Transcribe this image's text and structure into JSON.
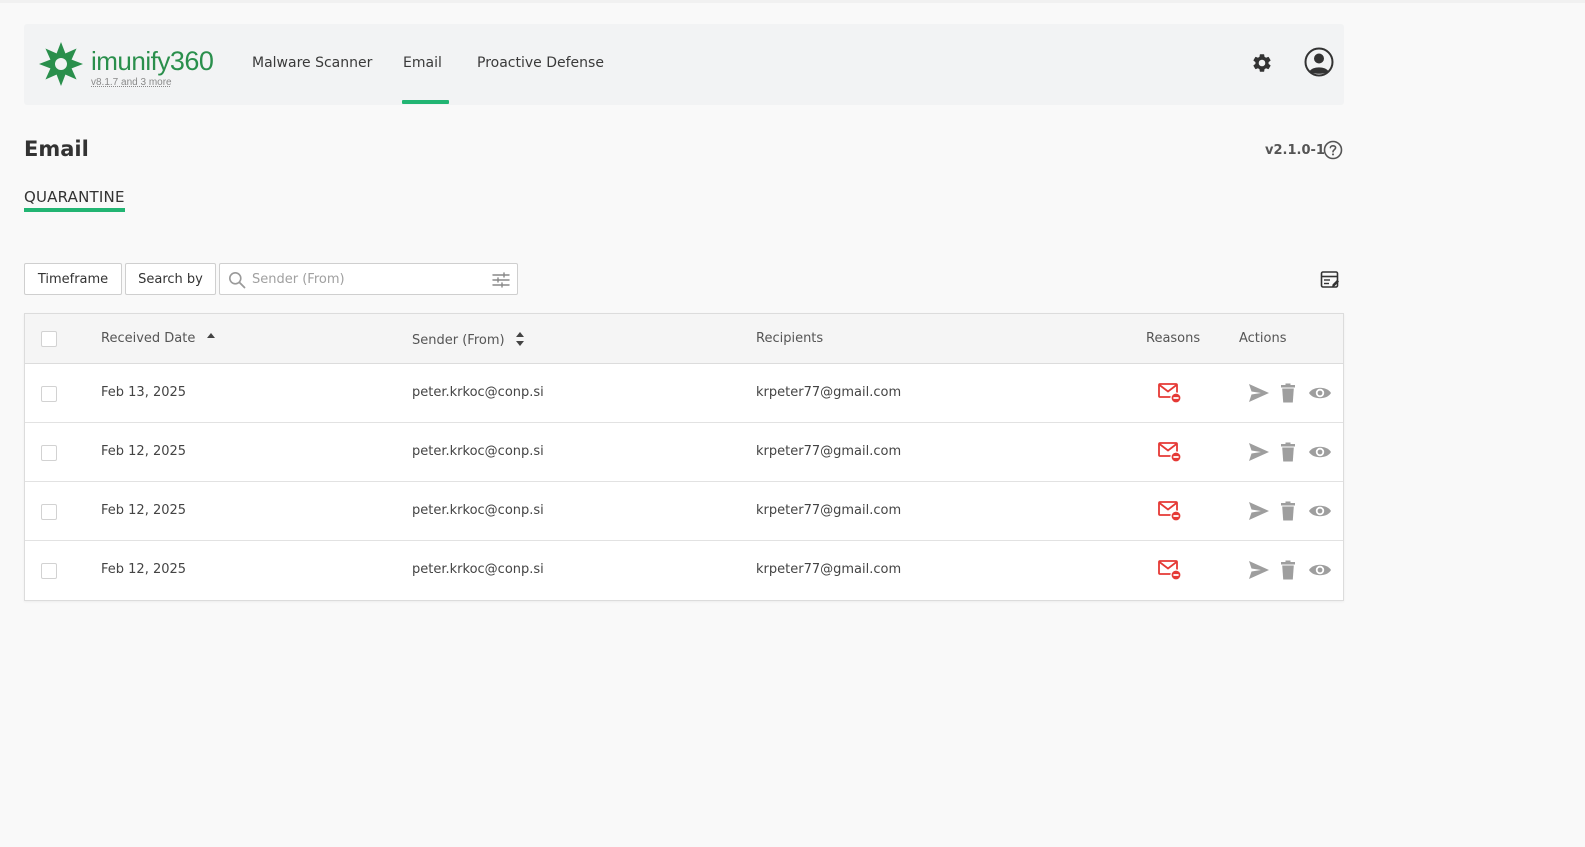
{
  "header": {
    "brand_text": "imunify",
    "brand_num": "360",
    "version_link": "v8.1.7 and 3 more",
    "nav": [
      {
        "label": "Malware Scanner"
      },
      {
        "label": "Email"
      },
      {
        "label": "Proactive Defense"
      }
    ],
    "active_nav": "Email",
    "icons": {
      "settings": "gear-icon",
      "user": "user-avatar-icon"
    }
  },
  "page": {
    "title": "Email",
    "version": "v2.1.0-1",
    "tab": "QUARANTINE"
  },
  "toolbar": {
    "timeframe_label": "Timeframe",
    "searchby_label": "Search by",
    "search_placeholder": "Sender (From)",
    "search_value": ""
  },
  "table": {
    "columns": {
      "received": "Received Date",
      "sender": "Sender (From)",
      "recipients": "Recipients",
      "reasons": "Reasons",
      "actions": "Actions"
    },
    "rows": [
      {
        "date": "Feb 13, 2025",
        "sender": "peter.krkoc@conp.si",
        "recipient": "krpeter77@gmail.com",
        "reason_icon": "mail-blocked-icon"
      },
      {
        "date": "Feb 12, 2025",
        "sender": "peter.krkoc@conp.si",
        "recipient": "krpeter77@gmail.com",
        "reason_icon": "mail-blocked-icon"
      },
      {
        "date": "Feb 12, 2025",
        "sender": "peter.krkoc@conp.si",
        "recipient": "krpeter77@gmail.com",
        "reason_icon": "mail-blocked-icon"
      },
      {
        "date": "Feb 12, 2025",
        "sender": "peter.krkoc@conp.si",
        "recipient": "krpeter77@gmail.com",
        "reason_icon": "mail-blocked-icon"
      }
    ]
  },
  "colors": {
    "accent": "#22b573",
    "brand": "#2a8f4c",
    "reason_red": "#e53935",
    "action_gray": "#9e9e9e"
  }
}
